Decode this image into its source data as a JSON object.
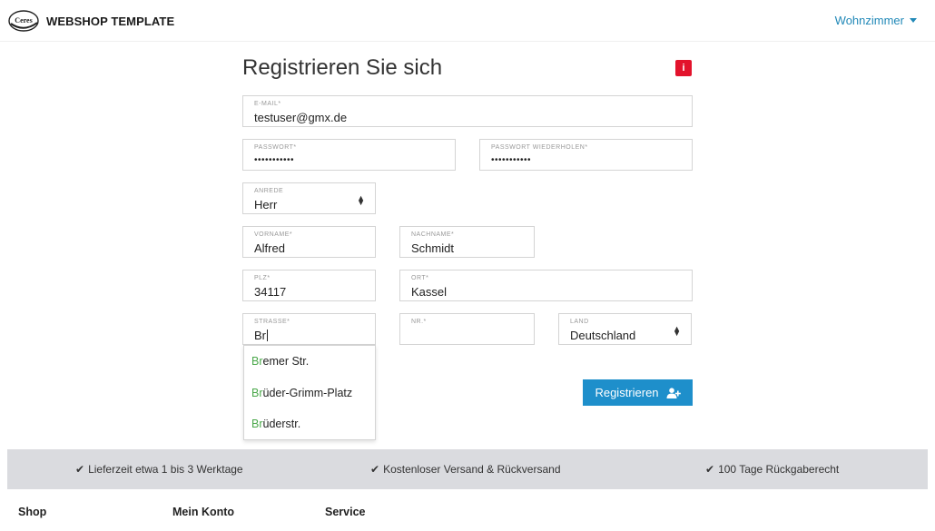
{
  "header": {
    "logo_text": "Ceres",
    "brand": "WEBSHOP TEMPLATE",
    "nav_dropdown": "Wohnzimmer"
  },
  "form": {
    "title": "Registrieren Sie sich",
    "info_icon": "i",
    "email": {
      "label": "E-MAIL*",
      "value": "testuser@gmx.de"
    },
    "password": {
      "label": "PASSWORT*",
      "value": "•••••••••••"
    },
    "password_repeat": {
      "label": "PASSWORT WIEDERHOLEN*",
      "value": "•••••••••••"
    },
    "salutation": {
      "label": "ANREDE",
      "value": "Herr"
    },
    "firstname": {
      "label": "VORNAME*",
      "value": "Alfred"
    },
    "lastname": {
      "label": "NACHNAME*",
      "value": "Schmidt"
    },
    "zip": {
      "label": "PLZ*",
      "value": "34117"
    },
    "city": {
      "label": "ORT*",
      "value": "Kassel"
    },
    "street": {
      "label": "STRASSE*",
      "value": "Br"
    },
    "number": {
      "label": "NR.*",
      "value": ""
    },
    "country": {
      "label": "LAND",
      "value": "Deutschland"
    },
    "suggestions": [
      {
        "match": "Br",
        "rest": "emer Str."
      },
      {
        "match": "Br",
        "rest": "üder-Grimm-Platz"
      },
      {
        "match": "Br",
        "rest": "üderstr."
      }
    ],
    "submit_label": "Registrieren"
  },
  "features": [
    "Lieferzeit etwa 1 bis 3 Werktage",
    "Kostenloser Versand & Rückversand",
    "100 Tage Rückgaberecht"
  ],
  "footer": {
    "columns": [
      "Shop",
      "Mein Konto",
      "Service"
    ]
  },
  "colors": {
    "accent": "#2289b8",
    "button": "#1e8fcb",
    "info": "#e3132c",
    "match": "#4ba84b",
    "features_bg": "#dadbdf"
  }
}
